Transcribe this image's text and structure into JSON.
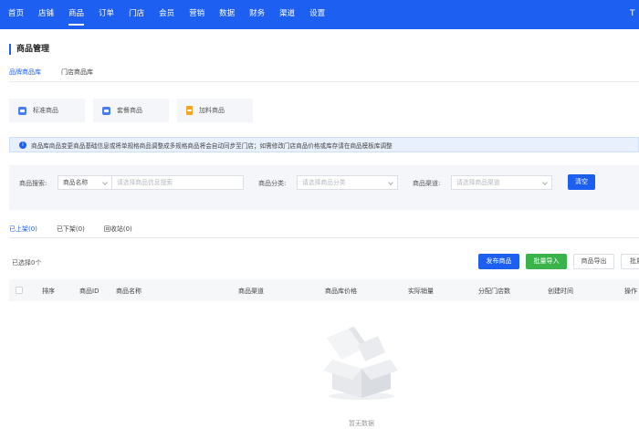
{
  "nav": {
    "items": [
      "首页",
      "店铺",
      "商品",
      "订单",
      "门店",
      "会员",
      "营销",
      "数据",
      "财务",
      "渠道",
      "设置"
    ],
    "active": "商品",
    "corner_text": "T"
  },
  "page": {
    "title": "商品管理"
  },
  "library_tabs": [
    "品牌商品库",
    "门店商品库"
  ],
  "type_cards": [
    {
      "label": "标准商品",
      "icon": "standard-product-icon"
    },
    {
      "label": "套餐商品",
      "icon": "combo-product-icon"
    },
    {
      "label": "加料商品",
      "icon": "addon-product-icon"
    }
  ],
  "alert": {
    "text": "商品库商品变更商品基础信息或将单规格商品调整成多规格商品将会自动同步至门店；如需修改门店商品价格或库存请在商品模板库调整"
  },
  "filters": {
    "search_label": "商品搜索:",
    "search_field_value": "商品名称",
    "search_placeholder": "请选择商品信息搜索",
    "category_label": "商品分类:",
    "category_placeholder": "请选择商品分类",
    "channel_label": "商品渠道:",
    "channel_placeholder": "请选择商品渠道",
    "clear_label": "清空"
  },
  "status_tabs": [
    "已上架(0)",
    "已下架(0)",
    "回收站(0)"
  ],
  "toolbar": {
    "selected_text": "已选择0个",
    "publish": "发布商品",
    "batch_import": "批量导入",
    "export": "商品导出",
    "batch": "批量"
  },
  "table": {
    "headers": [
      "排序",
      "商品ID",
      "商品名称",
      "商品渠道",
      "商品库价格",
      "实际销量",
      "分配门店数",
      "创建时间",
      "操作"
    ]
  },
  "empty": {
    "text": "暂无数据"
  },
  "colors": {
    "primary": "#1d5ff0",
    "success": "#3ab34a",
    "addon_icon": "#f5a524"
  }
}
